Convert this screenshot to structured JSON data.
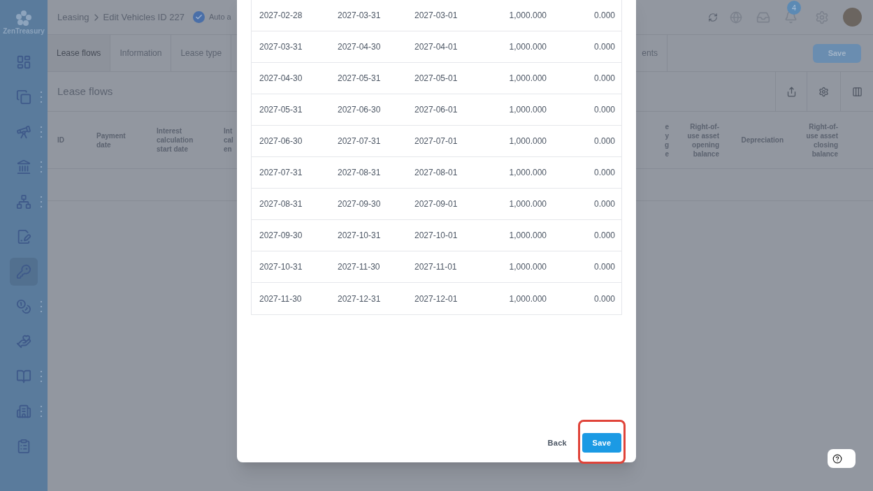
{
  "sidebar": {
    "logo": "ZenTreasury",
    "items": [
      {
        "kind": "dashboard",
        "has_menu": false,
        "selected": false
      },
      {
        "kind": "cards",
        "has_menu": true,
        "selected": false
      },
      {
        "kind": "telescope",
        "has_menu": true,
        "selected": false
      },
      {
        "kind": "bank",
        "has_menu": true,
        "selected": false
      },
      {
        "kind": "network",
        "has_menu": true,
        "selected": false
      },
      {
        "kind": "contract",
        "has_menu": false,
        "selected": false
      },
      {
        "kind": "key-house",
        "has_menu": false,
        "selected": true
      },
      {
        "kind": "moneybag",
        "has_menu": true,
        "selected": false
      },
      {
        "kind": "hands-house",
        "has_menu": false,
        "selected": false
      },
      {
        "kind": "book",
        "has_menu": true,
        "selected": false
      },
      {
        "kind": "building",
        "has_menu": true,
        "selected": false
      },
      {
        "kind": "clipboard",
        "has_menu": false,
        "selected": false
      }
    ]
  },
  "header": {
    "breadcrumb": [
      "Leasing",
      "Edit Vehicles ID 227"
    ],
    "status": "Auto a",
    "notifications": "4"
  },
  "tabs": [
    {
      "label": "Lease flows",
      "selected": true
    },
    {
      "label": "Information",
      "selected": false
    },
    {
      "label": "Lease type",
      "selected": false
    },
    {
      "label": "ents",
      "selected": false
    }
  ],
  "save_button": "Save",
  "section": {
    "title": "Lease flows"
  },
  "table": {
    "columns_left": [
      "ID",
      "Payment date",
      "Interest calculation start date",
      "Int cal en"
    ],
    "columns_right": [
      "e y g e",
      "Right-of-use asset opening balance",
      "Depreciation",
      "Right-of-use asset closing balance"
    ]
  },
  "modal": {
    "rows": [
      [
        "2027-02-28",
        "2027-03-31",
        "2027-03-01",
        "1,000.000",
        "0.000"
      ],
      [
        "2027-03-31",
        "2027-04-30",
        "2027-04-01",
        "1,000.000",
        "0.000"
      ],
      [
        "2027-04-30",
        "2027-05-31",
        "2027-05-01",
        "1,000.000",
        "0.000"
      ],
      [
        "2027-05-31",
        "2027-06-30",
        "2027-06-01",
        "1,000.000",
        "0.000"
      ],
      [
        "2027-06-30",
        "2027-07-31",
        "2027-07-01",
        "1,000.000",
        "0.000"
      ],
      [
        "2027-07-31",
        "2027-08-31",
        "2027-08-01",
        "1,000.000",
        "0.000"
      ],
      [
        "2027-08-31",
        "2027-09-30",
        "2027-09-01",
        "1,000.000",
        "0.000"
      ],
      [
        "2027-09-30",
        "2027-10-31",
        "2027-10-01",
        "1,000.000",
        "0.000"
      ],
      [
        "2027-10-31",
        "2027-11-30",
        "2027-11-01",
        "1,000.000",
        "0.000"
      ],
      [
        "2027-11-30",
        "2027-12-31",
        "2027-12-01",
        "1,000.000",
        "0.000"
      ]
    ],
    "back": "Back",
    "save": "Save",
    "save_highlighted": true
  }
}
